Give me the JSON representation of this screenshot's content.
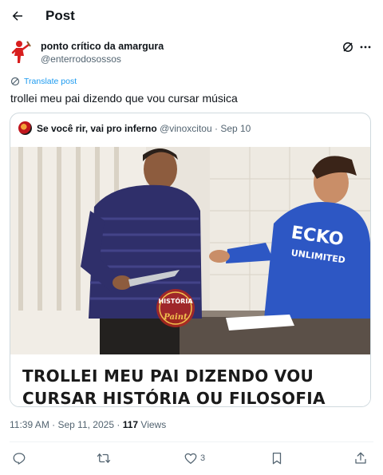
{
  "header": {
    "title": "Post"
  },
  "author": {
    "display_name": "ponto crítico da amargura",
    "handle": "@enterrodosossos"
  },
  "translate": {
    "label": "Translate post"
  },
  "tweet": {
    "text": "trollei meu pai dizendo que vou cursar música"
  },
  "quote": {
    "display_name": "Se você rir, vai pro inferno",
    "handle": "@vinoxcitou",
    "separator": "·",
    "date": "Sep 10",
    "media": {
      "caption_line1": "TROLLEI MEU PAI DIZENDO VOU",
      "caption_line2": "CURSAR HISTÓRIA OU FILOSOFIA",
      "sweatshirt_brand": "ECKO",
      "sweatshirt_sub": "UNLIMITED",
      "watermark_top": "HISTÓRIA",
      "watermark_bottom": "Paint"
    }
  },
  "meta": {
    "time": "11:39 AM",
    "separator": "·",
    "date": "Sep 11, 2025",
    "separator2": "·",
    "views_count": "117",
    "views_label": "Views"
  },
  "actions": {
    "reply_count": "",
    "retweet_count": "",
    "like_count": "3"
  },
  "colors": {
    "accent": "#1d9bf0",
    "text": "#0f1419",
    "secondary": "#536471",
    "border": "#cfd9de"
  },
  "icons": [
    "back-arrow-icon",
    "grok-icon",
    "more-icon",
    "translate-icon",
    "reply-icon",
    "retweet-icon",
    "like-icon",
    "bookmark-icon",
    "share-icon"
  ]
}
